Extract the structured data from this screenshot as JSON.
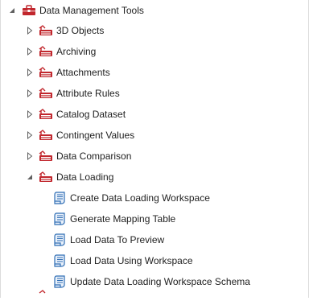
{
  "tree": {
    "root": {
      "label": "Data Management Tools",
      "icon": "toolbox-icon",
      "expanded": true
    },
    "toolsets": [
      {
        "label": "3D Objects",
        "icon": "toolset-icon",
        "expanded": false
      },
      {
        "label": "Archiving",
        "icon": "toolset-icon",
        "expanded": false
      },
      {
        "label": "Attachments",
        "icon": "toolset-icon",
        "expanded": false
      },
      {
        "label": "Attribute Rules",
        "icon": "toolset-icon",
        "expanded": false
      },
      {
        "label": "Catalog Dataset",
        "icon": "toolset-icon",
        "expanded": false
      },
      {
        "label": "Contingent Values",
        "icon": "toolset-icon",
        "expanded": false
      },
      {
        "label": "Data Comparison",
        "icon": "toolset-icon",
        "expanded": false
      },
      {
        "label": "Data Loading",
        "icon": "toolset-icon",
        "expanded": true
      }
    ],
    "data_loading_tools": [
      {
        "label": "Create Data Loading Workspace",
        "icon": "script-tool-icon"
      },
      {
        "label": "Generate Mapping Table",
        "icon": "script-tool-icon"
      },
      {
        "label": "Load Data To Preview",
        "icon": "script-tool-icon"
      },
      {
        "label": "Load Data Using Workspace",
        "icon": "script-tool-icon"
      },
      {
        "label": "Update Data Loading Workspace Schema",
        "icon": "script-tool-icon"
      }
    ]
  },
  "colors": {
    "toolbox_red": "#c1272d",
    "script_blue": "#2e6db4",
    "arrow_gray": "#606060"
  }
}
